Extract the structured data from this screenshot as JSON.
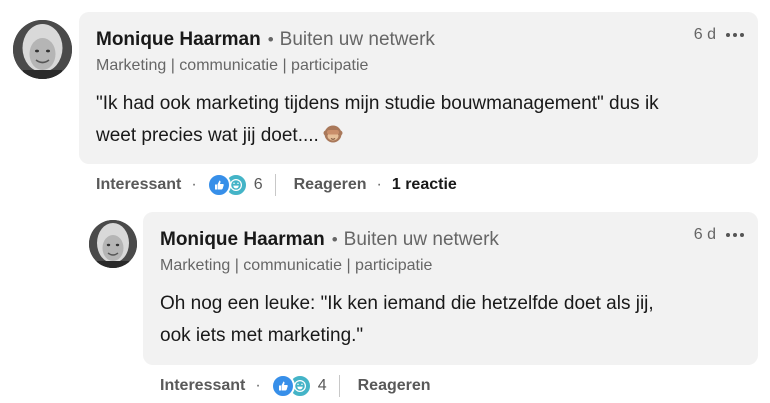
{
  "comments": [
    {
      "author": "Monique Haarman",
      "network": "Buiten uw netwerk",
      "headline": "Marketing | communicatie | participatie",
      "time": "6 d",
      "text_line1": "\"Ik had ook marketing tijdens mijn studie bouwmanagement\" dus ik",
      "text_line2": "weet precies wat jij doet....",
      "emoji": "see-no-evil-monkey",
      "like_label": "Interessant",
      "reaction_count": "6",
      "reply_label": "Reageren",
      "replies": "1 reactie"
    },
    {
      "author": "Monique Haarman",
      "network": "Buiten uw netwerk",
      "headline": "Marketing | communicatie | participatie",
      "time": "6 d",
      "text_line1": "Oh nog een leuke: \"Ik ken iemand die hetzelfde doet als jij,",
      "text_line2": "ook iets met marketing.\"",
      "like_label": "Interessant",
      "reaction_count": "4",
      "reply_label": "Reageren"
    }
  ],
  "icons": {
    "reactions": [
      "like-icon",
      "funny-icon"
    ],
    "more": "more-options-icon"
  },
  "colors": {
    "bubble": "#f2f2f2",
    "like": "#378fe9",
    "funny": "#44b4c7",
    "secondary_text": "#666666"
  }
}
